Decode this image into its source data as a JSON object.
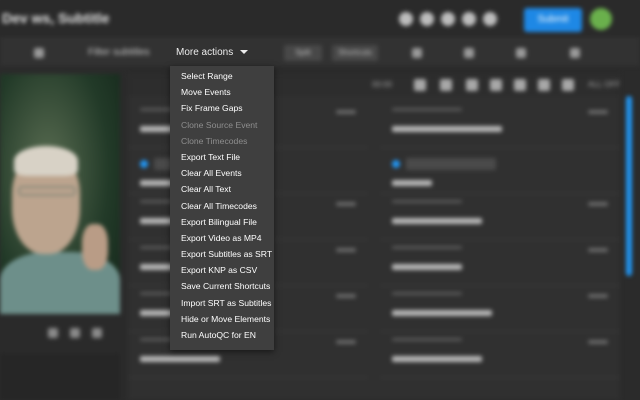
{
  "header": {
    "title": "Dev ws, Subtitle",
    "submit_label": "Submit",
    "avatar_initial": "",
    "accent_color": "#1e88e5"
  },
  "toolbar": {
    "filter_label": "Filter subtitles",
    "more_actions_label": "More actions",
    "buttons": [
      "Split",
      "Shortcuts"
    ]
  },
  "list": {
    "timecode_header": "00:00",
    "zoom_label": "ALL OFF"
  },
  "menu": {
    "items": [
      {
        "label": "Select Range",
        "enabled": true
      },
      {
        "label": "Move Events",
        "enabled": true
      },
      {
        "label": "Fix Frame Gaps",
        "enabled": true
      },
      {
        "label": "Clone Source Event",
        "enabled": false
      },
      {
        "label": "Clone Timecodes",
        "enabled": false
      },
      {
        "label": "Export Text File",
        "enabled": true
      },
      {
        "label": "Clear All Events",
        "enabled": true
      },
      {
        "label": "Clear All Text",
        "enabled": true
      },
      {
        "label": "Clear All Timecodes",
        "enabled": true
      },
      {
        "label": "Export Bilingual File",
        "enabled": true
      },
      {
        "label": "Export Video as MP4",
        "enabled": true
      },
      {
        "label": "Export Subtitles as SRT",
        "enabled": true
      },
      {
        "label": "Export KNP as CSV",
        "enabled": true
      },
      {
        "label": "Save Current Shortcuts",
        "enabled": true
      },
      {
        "label": "Import SRT as Subtitles",
        "enabled": true
      },
      {
        "label": "Hide or Move Elements",
        "enabled": true
      },
      {
        "label": "Run AutoQC for EN",
        "enabled": true
      }
    ]
  }
}
